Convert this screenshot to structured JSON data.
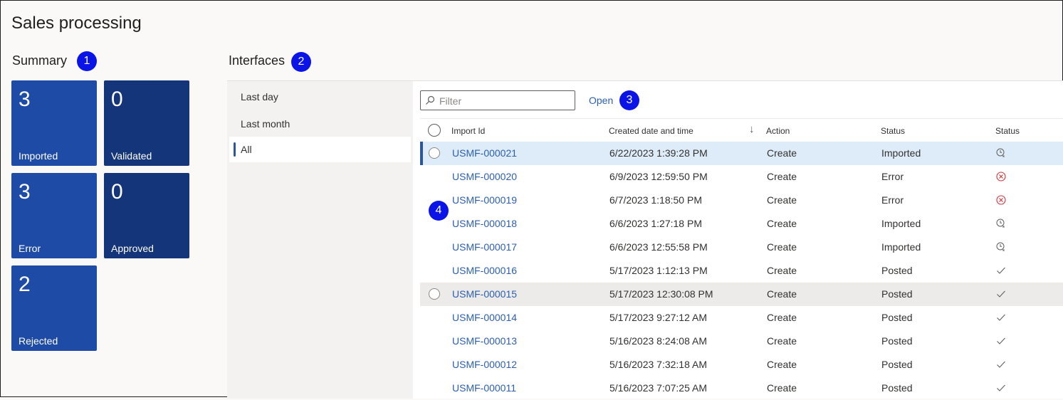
{
  "page": {
    "title": "Sales processing"
  },
  "summary": {
    "title": "Summary",
    "badge": "1",
    "tiles": [
      {
        "count": "3",
        "label": "Imported"
      },
      {
        "count": "0",
        "label": "Validated"
      },
      {
        "count": "3",
        "label": "Error"
      },
      {
        "count": "0",
        "label": "Approved"
      },
      {
        "count": "2",
        "label": "Rejected"
      }
    ]
  },
  "interfaces": {
    "title": "Interfaces",
    "badge": "2",
    "nav": [
      "Last day",
      "Last month",
      "All"
    ],
    "selected_nav": "All",
    "filter_placeholder": "Filter",
    "open_label": "Open",
    "open_badge": "3",
    "rows_badge": "4",
    "columns": [
      "Import Id",
      "Created date and time",
      "Action",
      "Status",
      "Status"
    ],
    "sort_glyph": "↓",
    "rows": [
      {
        "id": "USMF-000021",
        "created": "6/22/2023 1:39:28 PM",
        "action": "Create",
        "status": "Imported",
        "icon": "clock-icon"
      },
      {
        "id": "USMF-000020",
        "created": "6/9/2023 12:59:50 PM",
        "action": "Create",
        "status": "Error",
        "icon": "error-icon"
      },
      {
        "id": "USMF-000019",
        "created": "6/7/2023 1:18:50 PM",
        "action": "Create",
        "status": "Error",
        "icon": "error-icon"
      },
      {
        "id": "USMF-000018",
        "created": "6/6/2023 1:27:18 PM",
        "action": "Create",
        "status": "Imported",
        "icon": "clock-icon"
      },
      {
        "id": "USMF-000017",
        "created": "6/6/2023 12:55:58 PM",
        "action": "Create",
        "status": "Imported",
        "icon": "clock-icon"
      },
      {
        "id": "USMF-000016",
        "created": "5/17/2023 1:12:13 PM",
        "action": "Create",
        "status": "Posted",
        "icon": "check-icon"
      },
      {
        "id": "USMF-000015",
        "created": "5/17/2023 12:30:08 PM",
        "action": "Create",
        "status": "Posted",
        "icon": "check-icon"
      },
      {
        "id": "USMF-000014",
        "created": "5/17/2023 9:27:12 AM",
        "action": "Create",
        "status": "Posted",
        "icon": "check-icon"
      },
      {
        "id": "USMF-000013",
        "created": "5/16/2023 8:24:08 AM",
        "action": "Create",
        "status": "Posted",
        "icon": "check-icon"
      },
      {
        "id": "USMF-000012",
        "created": "5/16/2023 7:32:18 AM",
        "action": "Create",
        "status": "Posted",
        "icon": "check-icon"
      },
      {
        "id": "USMF-000011",
        "created": "5/16/2023 7:07:25 AM",
        "action": "Create",
        "status": "Posted",
        "icon": "check-icon"
      }
    ]
  },
  "colors": {
    "tile_blue": "#1e4ba6",
    "tile_navy": "#14357a",
    "badge": "#0a14e6",
    "link": "#2b5fb5",
    "error": "#d13438",
    "selected_row": "#deecf9"
  }
}
